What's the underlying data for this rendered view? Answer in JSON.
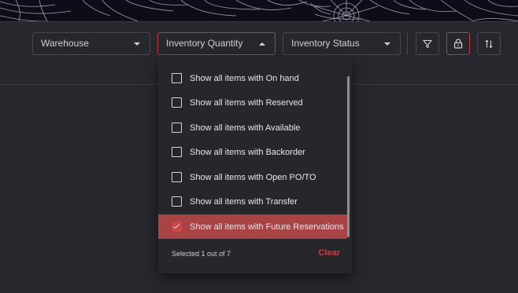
{
  "filters": {
    "warehouse": {
      "label": "Warehouse"
    },
    "inventory_quantity": {
      "label": "Inventory Quantity",
      "open": true
    },
    "inventory_status": {
      "label": "Inventory Status"
    }
  },
  "toolbar_icons": [
    "filter-icon",
    "lock-icon",
    "sort-icon"
  ],
  "dropdown": {
    "options": [
      {
        "label": "Show all items with On hand",
        "checked": false
      },
      {
        "label": "Show all items with Reserved",
        "checked": false
      },
      {
        "label": "Show all items with Available",
        "checked": false
      },
      {
        "label": "Show all items with Backorder",
        "checked": false
      },
      {
        "label": "Show all items with Open PO/TO",
        "checked": false
      },
      {
        "label": "Show all items with Transfer",
        "checked": false
      },
      {
        "label": "Show all items with Future Reservations",
        "checked": true
      }
    ],
    "selected_text": "Selected 1 out of 7",
    "clear_label": "Clear"
  },
  "colors": {
    "accent": "#c0393b",
    "selected_row": "#a84446",
    "panel": "#27272d",
    "background": "#0d0d1a"
  }
}
